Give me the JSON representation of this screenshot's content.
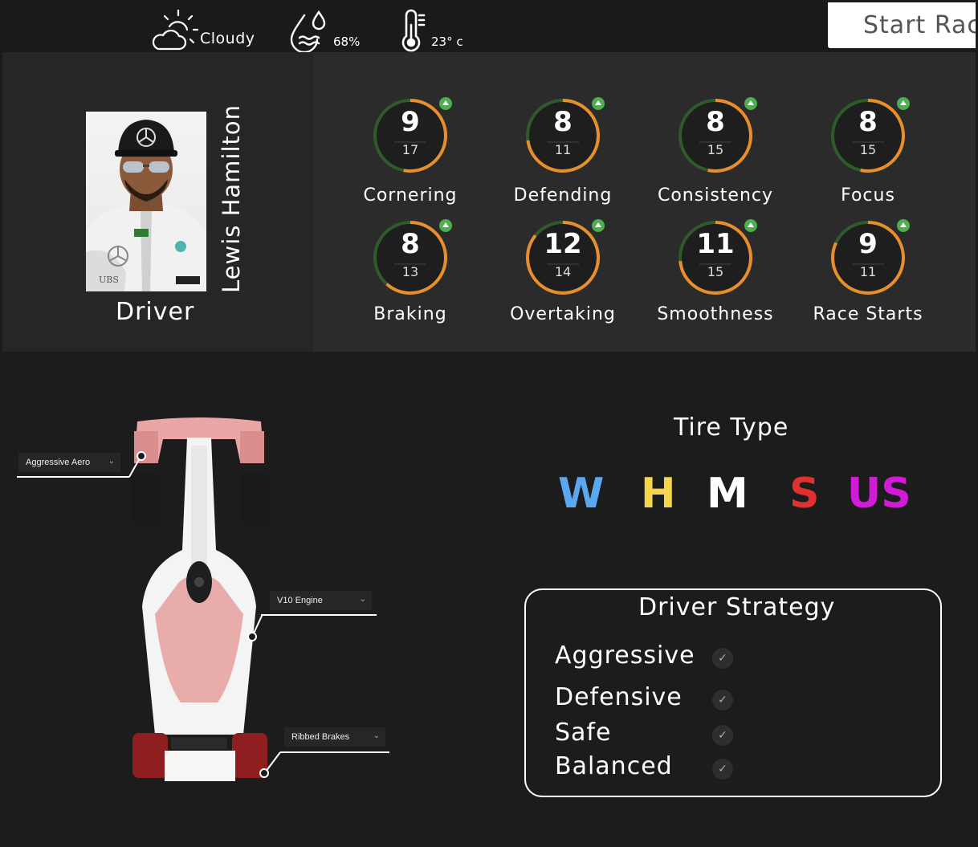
{
  "weather": {
    "condition": "Cloudy",
    "humidity": "68%",
    "temperature": "23° c"
  },
  "start_button_label": "Start Race",
  "driver": {
    "name": "Lewis Hamilton",
    "role": "Driver"
  },
  "stats": [
    {
      "label": "Cornering",
      "value": "9",
      "max": "17"
    },
    {
      "label": "Defending",
      "value": "8",
      "max": "11"
    },
    {
      "label": "Consistency",
      "value": "8",
      "max": "15"
    },
    {
      "label": "Focus",
      "value": "8",
      "max": "15"
    },
    {
      "label": "Braking",
      "value": "8",
      "max": "13"
    },
    {
      "label": "Overtaking",
      "value": "12",
      "max": "14"
    },
    {
      "label": "Smoothness",
      "value": "11",
      "max": "15"
    },
    {
      "label": "Race Starts",
      "value": "9",
      "max": "11"
    }
  ],
  "car_parts": {
    "aero": "Aggressive Aero",
    "engine": "V10 Engine",
    "brakes": "Ribbed Brakes"
  },
  "tires": {
    "title": "Tire Type",
    "options": [
      {
        "label": "W",
        "color": "#5aa9f0"
      },
      {
        "label": "H",
        "color": "#f3d64e"
      },
      {
        "label": "M",
        "color": "#ffffff"
      },
      {
        "label": "S",
        "color": "#e0302f"
      },
      {
        "label": "US",
        "color": "#d21bd6"
      }
    ]
  },
  "strategy": {
    "title": "Driver Strategy",
    "options": [
      "Aggressive",
      "Defensive",
      "Safe",
      "Balanced"
    ]
  },
  "colors": {
    "gauge_progress": "#e88e2c",
    "gauge_base": "#2f5a2c",
    "boost_indicator": "#4caf50"
  }
}
